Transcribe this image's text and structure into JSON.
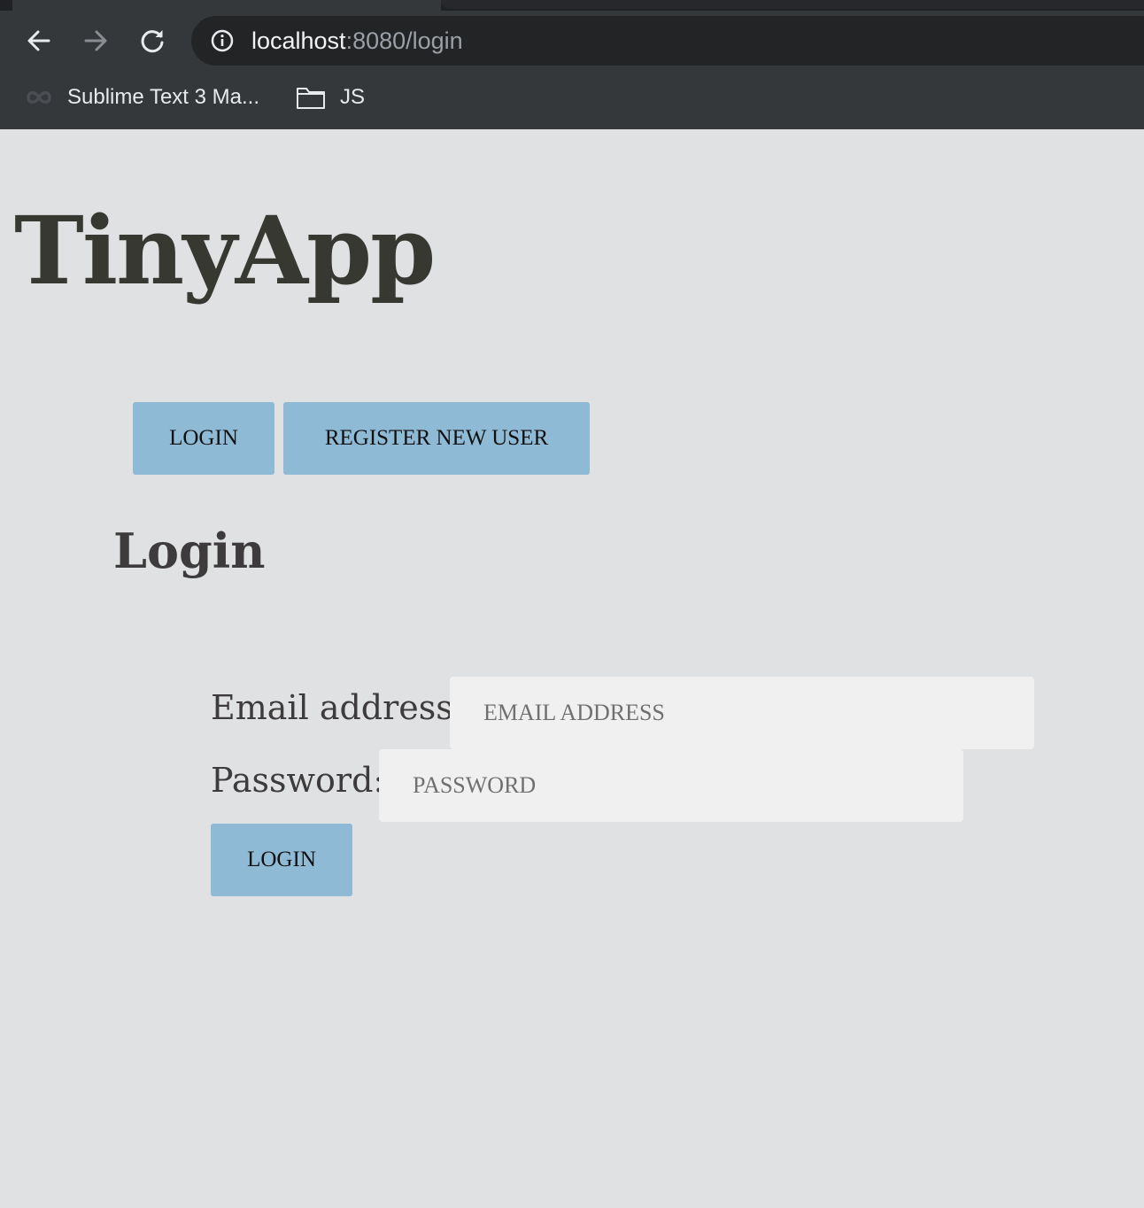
{
  "browser": {
    "url_host": "localhost",
    "url_path": ":8080/login",
    "bookmarks": [
      {
        "label": "Sublime Text 3 Ma...",
        "icon": "infinity-icon"
      },
      {
        "label": "JS",
        "icon": "folder-icon"
      }
    ],
    "nav_icons": [
      "back-arrow-icon",
      "forward-arrow-icon",
      "reload-icon",
      "info-icon"
    ]
  },
  "page": {
    "app_title": "TinyApp",
    "nav": {
      "login_label": "LOGIN",
      "register_label": "REGISTER NEW USER"
    },
    "section_title": "Login",
    "form": {
      "email_label": "Email address:",
      "email_placeholder": "EMAIL ADDRESS",
      "password_label": "Password:",
      "password_placeholder": "PASSWORD",
      "submit_label": "LOGIN"
    }
  },
  "colors": {
    "page_background": "#e0e1e3",
    "button_background": "#8fbad6",
    "input_background": "#f0f0f0",
    "title_text": "#383832",
    "chrome_background": "#35383b"
  }
}
